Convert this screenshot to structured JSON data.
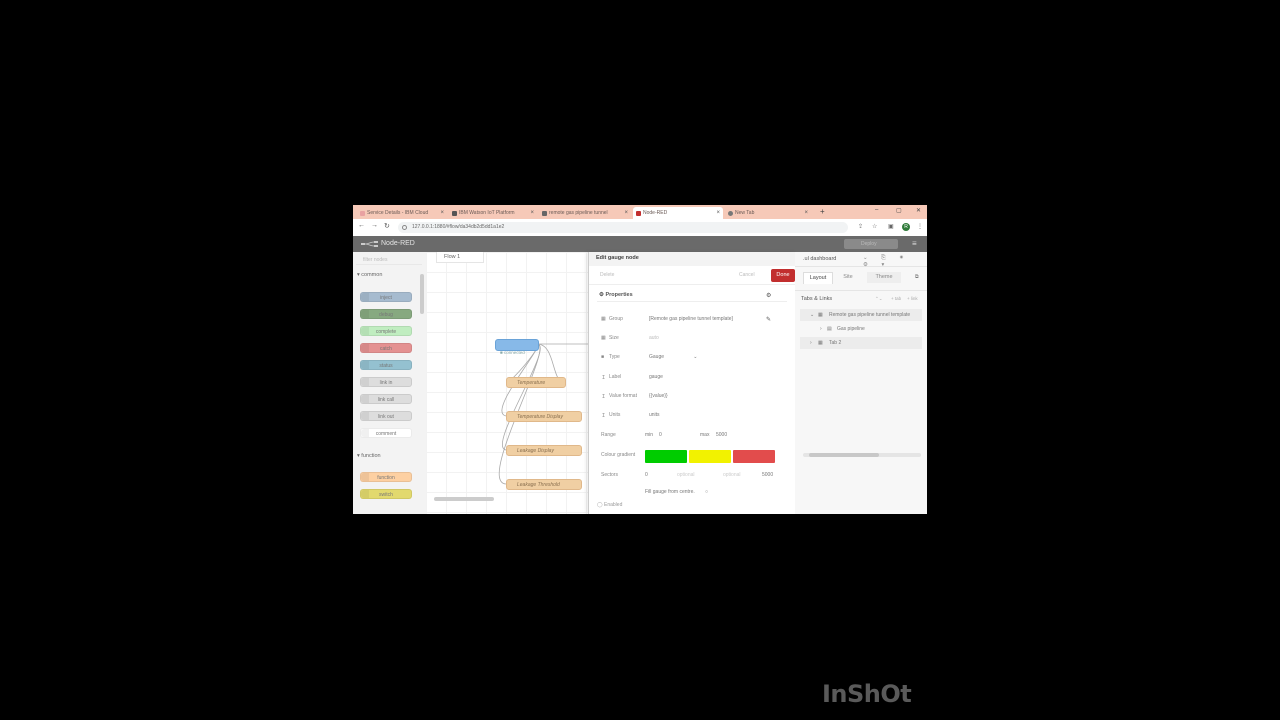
{
  "browser": {
    "tabs": [
      {
        "title": "Service Details - IBM Cloud",
        "favicon_color": "#e9a2a2",
        "active": false
      },
      {
        "title": "IBM Watson IoT Platform",
        "favicon_color": "#555555",
        "active": false
      },
      {
        "title": "remote gas pipeline tunnel",
        "favicon_color": "#666666",
        "active": false
      },
      {
        "title": "Node-RED",
        "favicon_color": "#c22e2e",
        "active": true
      },
      {
        "title": "New Tab",
        "favicon_color": "#777777",
        "active": false
      }
    ],
    "url": "127.0.0.1:1880/#flow/da34db2d5dd1a1e2",
    "profile_initial": "R"
  },
  "app": {
    "title": "Node-RED",
    "deploy_label": "Deploy"
  },
  "palette": {
    "filter_placeholder": "filter nodes",
    "categories": [
      {
        "name": "common",
        "nodes": [
          {
            "label": "inject",
            "color": "#a6bbcf"
          },
          {
            "label": "debug",
            "color": "#87a980"
          },
          {
            "label": "complete",
            "color": "#c0edc0"
          },
          {
            "label": "catch",
            "color": "#e49191"
          },
          {
            "label": "status",
            "color": "#94c1d0"
          },
          {
            "label": "link in",
            "color": "#dddddd"
          },
          {
            "label": "link call",
            "color": "#dddddd"
          },
          {
            "label": "link out",
            "color": "#dddddd"
          },
          {
            "label": "comment",
            "color": "#ffffff"
          }
        ]
      },
      {
        "name": "function",
        "nodes": [
          {
            "label": "function",
            "color": "#fdd0a2"
          },
          {
            "label": "switch",
            "color": "#e2d96e"
          }
        ]
      }
    ]
  },
  "workspace": {
    "flow_tab": "Flow 1",
    "inject_status": "connected",
    "nodes": [
      "Temperature",
      "Temperature Display",
      "Leakage Display",
      "Leakage Threshold"
    ]
  },
  "edit_panel": {
    "title": "Edit gauge node",
    "delete_label": "Delete",
    "cancel_label": "Cancel",
    "done_label": "Done",
    "section": "Properties",
    "group_label": "Group",
    "group_value": "[Remote gas pipeline tunnel template]",
    "size_label": "Size",
    "size_value": "auto",
    "type_label": "Type",
    "type_value": "Gauge",
    "label_label": "Label",
    "label_value": "gauge",
    "format_label": "Value format",
    "format_value": "{{value}}",
    "units_label": "Units",
    "units_value": "units",
    "range_label": "Range",
    "range_min_label": "min",
    "range_min": "0",
    "range_max_label": "max",
    "range_max": "5000",
    "gradient_label": "Colour gradient",
    "gradient_colors": [
      "#00cc00",
      "#f2f200",
      "#e24c4c"
    ],
    "sectors_label": "Sectors",
    "sectors_start": "0",
    "sectors_optional_1": "optional",
    "sectors_optional_2": "optional",
    "sectors_end": "5000",
    "fill_label": "Fill gauge from centre.",
    "enabled_label": "Enabled"
  },
  "dashboard": {
    "title": "dashboard",
    "tabs": [
      "Layout",
      "Site",
      "Theme"
    ],
    "section": "Tabs & Links",
    "tree": [
      {
        "label": "Remote gas pipeline tunnel template",
        "level": 1
      },
      {
        "label": "Gas pipeline",
        "level": 2
      },
      {
        "label": "Tab 2",
        "level": 1
      }
    ]
  },
  "watermark": "InShOt"
}
